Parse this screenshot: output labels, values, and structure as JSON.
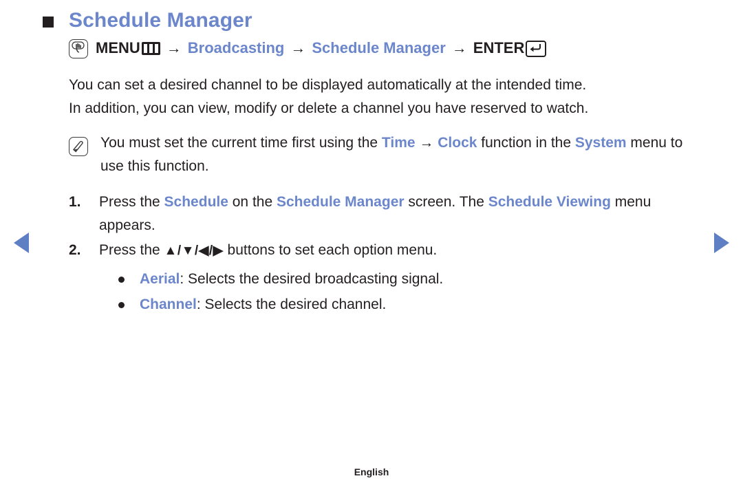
{
  "page": {
    "title": "Schedule Manager",
    "heading_bullet": "filled-square",
    "accent_color": "#6b86cb",
    "text_color": "#231f20"
  },
  "nav": {
    "prev_label": "◀",
    "next_label": "▶"
  },
  "menu_path": {
    "press_icon": "hand-press-icon",
    "menu_label": "MENU",
    "menu_glyph": "menu-three-bars-icon",
    "arrow": "→",
    "item1": "Broadcasting",
    "item2": "Schedule Manager",
    "enter_label": "ENTER",
    "enter_glyph": "enter-return-icon"
  },
  "intro": {
    "line1": "You can set a desired channel to be displayed automatically at the intended time.",
    "line2": "In addition, you can view, modify or delete a channel you have reserved to watch."
  },
  "note": {
    "icon": "note-pen-icon",
    "part1": "You must set the current time first using the ",
    "highlight1": "Time",
    "arrow": "→",
    "highlight2": "Clock",
    "part2": " function in the ",
    "highlight3": "System",
    "part3": " menu to use this function."
  },
  "steps": [
    {
      "number": "1.",
      "part1": "Press the ",
      "highlight1": "Schedule",
      "part2": " on the ",
      "highlight2": "Schedule Manager",
      "part3": " screen. The ",
      "highlight3": "Schedule Viewing",
      "part4": " menu appears."
    },
    {
      "number": "2.",
      "part1": "Press the ",
      "buttons": "▲/▼/◀/▶",
      "part2": " buttons to set each option menu."
    }
  ],
  "bullets": [
    {
      "term": "Aerial",
      "description": ": Selects the desired broadcasting signal."
    },
    {
      "term": "Channel",
      "description": ": Selects the desired channel."
    }
  ],
  "footer": {
    "language": "English"
  }
}
